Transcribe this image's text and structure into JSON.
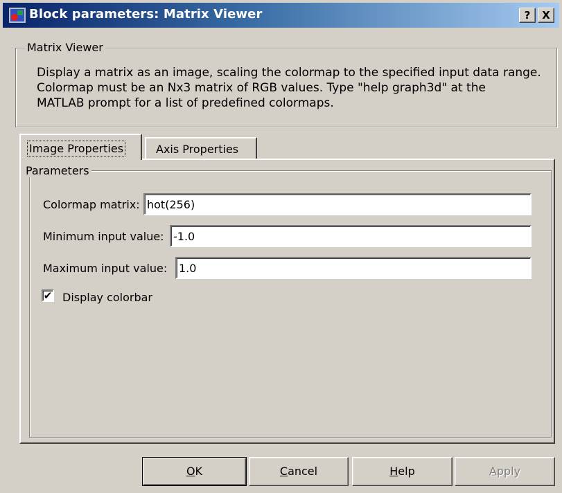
{
  "window": {
    "title": "Block parameters: Matrix Viewer",
    "help_button": "?",
    "close_button": "X"
  },
  "description_group": {
    "label": "Matrix Viewer",
    "lines": [
      "Display a matrix as an image, scaling the colormap to the specified input data range.",
      "Colormap must be an Nx3 matrix of RGB values.  Type \"help graph3d\" at the",
      "MATLAB prompt for a list of predefined colormaps."
    ]
  },
  "tabs": [
    {
      "label": "Image Properties",
      "active": true
    },
    {
      "label": "Axis Properties",
      "active": false
    }
  ],
  "parameters": {
    "group_label": "Parameters",
    "colormap": {
      "label": "Colormap matrix:",
      "value": "hot(256)"
    },
    "min_input": {
      "label": "Minimum input value:",
      "value": "-1.0"
    },
    "max_input": {
      "label": "Maximum input value:",
      "value": "1.0"
    },
    "display_colorbar": {
      "label": "Display colorbar",
      "checked": true
    }
  },
  "buttons": {
    "ok": {
      "mnemonic": "O",
      "rest": "K"
    },
    "cancel": {
      "mnemonic": "C",
      "rest": "ancel"
    },
    "help": {
      "mnemonic": "H",
      "rest": "elp"
    },
    "apply": {
      "mnemonic": "A",
      "rest": "pply"
    }
  },
  "colors": {
    "titlebar_start": "#0a246a",
    "titlebar_end": "#a6caf0",
    "face": "#d4d0c8"
  },
  "icons": {
    "app": "simulink-block-icon",
    "help": "help-question-icon",
    "close": "close-icon",
    "check": "checkmark-icon"
  }
}
